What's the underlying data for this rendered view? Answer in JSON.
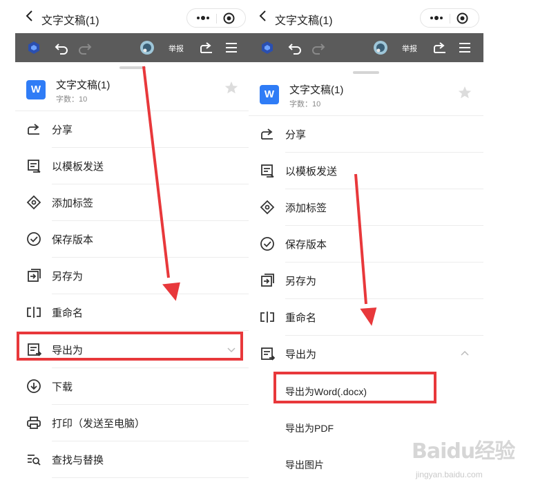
{
  "left_panel": {
    "title": "文字文稿(1)",
    "toolbar_report": "举报",
    "doc": {
      "icon_letter": "W",
      "name": "文字文稿(1)",
      "word_count": "字数：10"
    },
    "menu": [
      {
        "label": "分享",
        "icon": "share-icon"
      },
      {
        "label": "以模板发送",
        "icon": "template-send-icon"
      },
      {
        "label": "添加标签",
        "icon": "tag-icon"
      },
      {
        "label": "保存版本",
        "icon": "check-circle-icon"
      },
      {
        "label": "另存为",
        "icon": "save-as-icon"
      },
      {
        "label": "重命名",
        "icon": "rename-icon"
      },
      {
        "label": "导出为",
        "icon": "export-icon",
        "expanded": false
      },
      {
        "label": "下载",
        "icon": "download-icon"
      },
      {
        "label": "打印（发送至电脑）",
        "icon": "print-icon"
      },
      {
        "label": "查找与替换",
        "icon": "find-replace-icon"
      }
    ]
  },
  "right_panel": {
    "title": "文字文稿(1)",
    "toolbar_report": "举报",
    "doc": {
      "icon_letter": "W",
      "name": "文字文稿(1)",
      "word_count": "字数：10"
    },
    "menu": [
      {
        "label": "分享",
        "icon": "share-icon"
      },
      {
        "label": "以模板发送",
        "icon": "template-send-icon"
      },
      {
        "label": "添加标签",
        "icon": "tag-icon"
      },
      {
        "label": "保存版本",
        "icon": "check-circle-icon"
      },
      {
        "label": "另存为",
        "icon": "save-as-icon"
      },
      {
        "label": "重命名",
        "icon": "rename-icon"
      },
      {
        "label": "导出为",
        "icon": "export-icon",
        "expanded": true
      }
    ],
    "export_options": [
      {
        "label": "导出为Word(.docx)"
      },
      {
        "label": "导出为PDF"
      },
      {
        "label": "导出图片"
      }
    ]
  },
  "watermark": {
    "logo": "Baidu经验",
    "url": "jingyan.baidu.com"
  },
  "colors": {
    "highlight_red": "#e8383b",
    "word_blue": "#2f7cf6",
    "toolbar_gray": "#5b5b5b"
  }
}
